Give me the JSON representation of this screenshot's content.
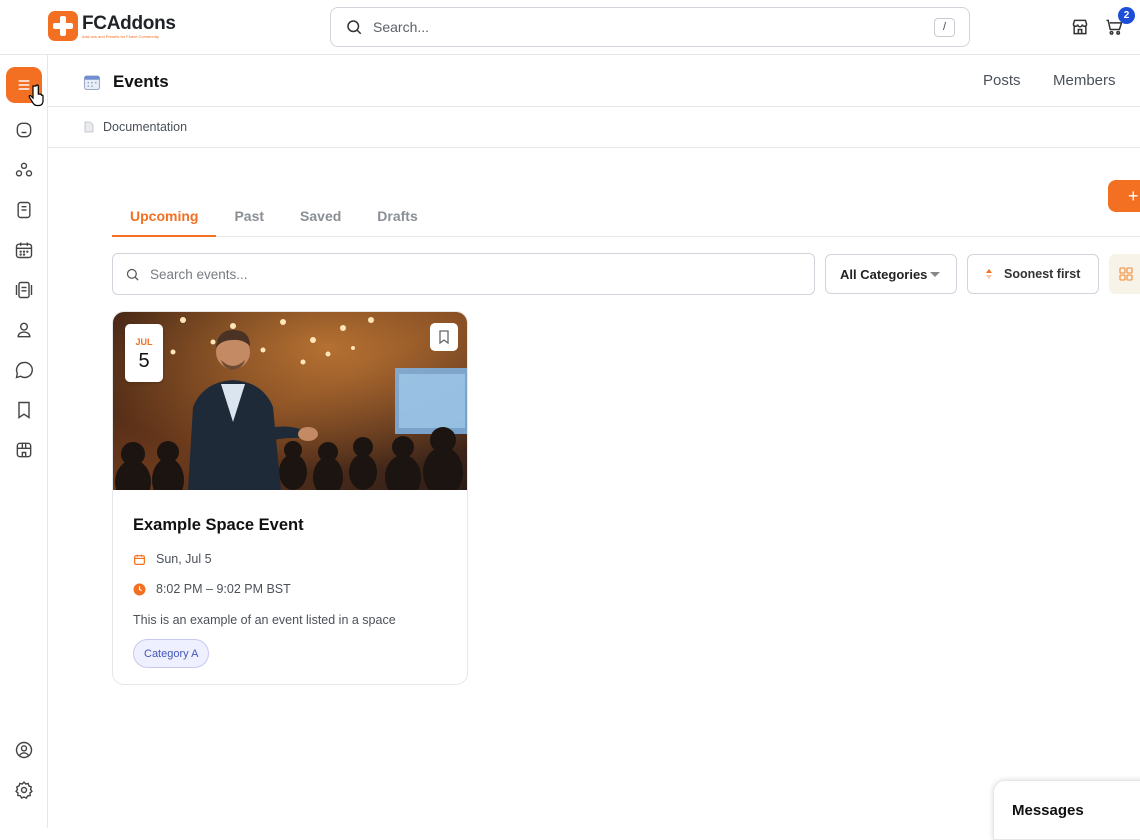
{
  "brand": {
    "name": "FCAddons",
    "tagline": "Add-ons and Presets for Fluent Community",
    "accent": "#f36f21"
  },
  "search": {
    "placeholder": "Search...",
    "shortcut": "/"
  },
  "cart": {
    "count": "2"
  },
  "sidebar": {
    "items": [
      "menu-icon",
      "home-icon",
      "spaces-icon",
      "courses-icon",
      "events-icon",
      "docs-icon",
      "members-icon",
      "chat-icon",
      "bookmarks-icon",
      "store-icon"
    ],
    "bottom": [
      "profile-icon",
      "settings-icon"
    ]
  },
  "header": {
    "title": "Events",
    "links": [
      "Posts",
      "Members"
    ]
  },
  "subbar": {
    "documentation": "Documentation"
  },
  "tabs": [
    "Upcoming",
    "Past",
    "Saved",
    "Drafts"
  ],
  "filters": {
    "search_placeholder": "Search events...",
    "category": "All Categories",
    "sort": "Soonest first"
  },
  "event": {
    "month": "JUL",
    "day": "5",
    "title": "Example Space Event",
    "date": "Sun, Jul 5",
    "time": "8:02 PM – 9:02 PM BST",
    "description": "This is an example of an event listed in a space",
    "category": "Category A"
  },
  "messages": {
    "label": "Messages"
  }
}
